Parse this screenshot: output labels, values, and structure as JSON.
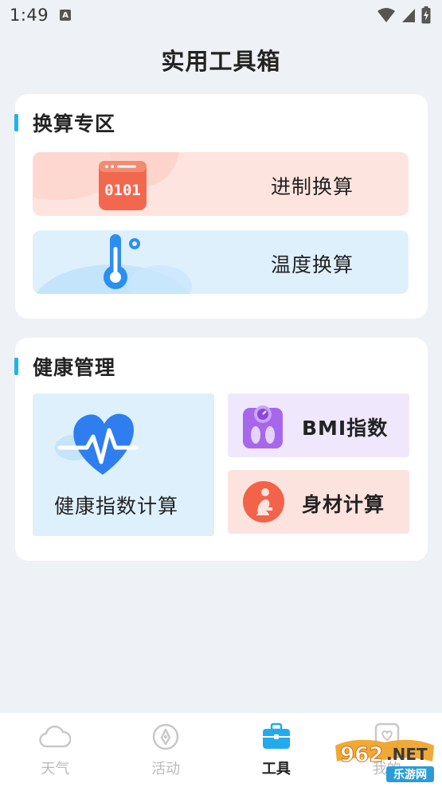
{
  "status": {
    "time": "1:49",
    "notif_letter": "A"
  },
  "page": {
    "title": "实用工具箱"
  },
  "convert_section": {
    "title": "换算专区",
    "base_label": "进制换算",
    "base_icon_text": "0101",
    "temp_label": "温度换算"
  },
  "health_section": {
    "title": "健康管理",
    "health_index_label": "健康指数计算",
    "bmi_label": "BMI指数",
    "body_label": "身材计算"
  },
  "tabs": [
    {
      "label": "天气",
      "icon": "cloud-icon"
    },
    {
      "label": "活动",
      "icon": "compass-icon"
    },
    {
      "label": "工具",
      "icon": "toolbox-icon"
    },
    {
      "label": "我的",
      "icon": "heart-frame-icon"
    }
  ],
  "watermark": {
    "brand": "962",
    "suffix": ".NET",
    "sub": "乐游网"
  },
  "colors": {
    "accent": "#1fb2f0",
    "active_tab_icon": "#22aaee",
    "inactive": "#c8c8c8"
  }
}
